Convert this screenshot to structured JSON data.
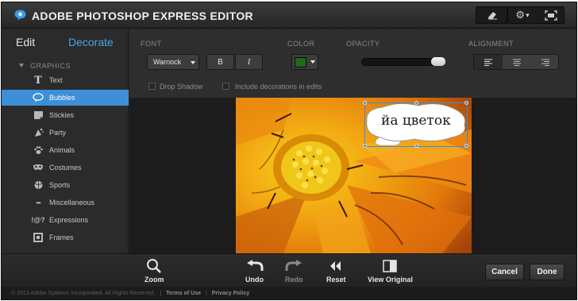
{
  "app": {
    "title": "ADOBE PHOTOSHOP EXPRESS EDITOR",
    "logo_icon": "speech-bubble-logo-icon",
    "toolbar_icons": [
      "eraser-icon",
      "gear-icon",
      "fullscreen-icon"
    ],
    "settings_caret": "▾"
  },
  "mode_tabs": {
    "edit": "Edit",
    "decorate": "Decorate"
  },
  "sidebar": {
    "section": "GRAPHICS",
    "items": [
      {
        "label": "Text",
        "icon": "text-t-icon",
        "glyph": "T"
      },
      {
        "label": "Bubbles",
        "icon": "speech-bubble-icon",
        "glyph": "",
        "selected": true
      },
      {
        "label": "Stickies",
        "icon": "sticky-note-icon",
        "glyph": ""
      },
      {
        "label": "Party",
        "icon": "party-icon",
        "glyph": ""
      },
      {
        "label": "Animals",
        "icon": "paw-icon",
        "glyph": ""
      },
      {
        "label": "Costumes",
        "icon": "mask-icon",
        "glyph": ""
      },
      {
        "label": "Sports",
        "icon": "ball-icon",
        "glyph": ""
      },
      {
        "label": "Miscellaneous",
        "icon": "dots-icon",
        "glyph": "•••"
      },
      {
        "label": "Expressions",
        "icon": "expressions-icon",
        "glyph": "!@?"
      },
      {
        "label": "Frames",
        "icon": "frame-icon",
        "glyph": ""
      }
    ]
  },
  "options": {
    "font_label": "FONT",
    "font_value": "Warnock",
    "bold_label": "B",
    "italic_label": "I",
    "color_label": "COLOR",
    "color_value": "#1e6a1e",
    "opacity_label": "OPACITY",
    "opacity_value": 1.0,
    "alignment_label": "ALIGNMENT",
    "alignment_options": [
      "left",
      "center",
      "right"
    ],
    "alignment_selected": "left",
    "drop_shadow_label": "Drop Shadow",
    "include_decorations_label": "Include decorations in edits"
  },
  "canvas": {
    "bubble_text": "йа цветок"
  },
  "bottom_toolbar": {
    "zoom": "Zoom",
    "undo": "Undo",
    "redo": "Redo",
    "reset": "Reset",
    "view_original": "View Original",
    "cancel": "Cancel",
    "done": "Done"
  },
  "footer": {
    "copyright": "© 2013 Adobe Systems Incorporated. All Rights Reserved.",
    "terms": "Terms of Use",
    "separator": "|",
    "privacy": "Privacy Policy"
  },
  "colors": {
    "accent": "#3d8fd8",
    "panel": "#2b2b2b",
    "canvas_bg": "#1c1c1c"
  }
}
